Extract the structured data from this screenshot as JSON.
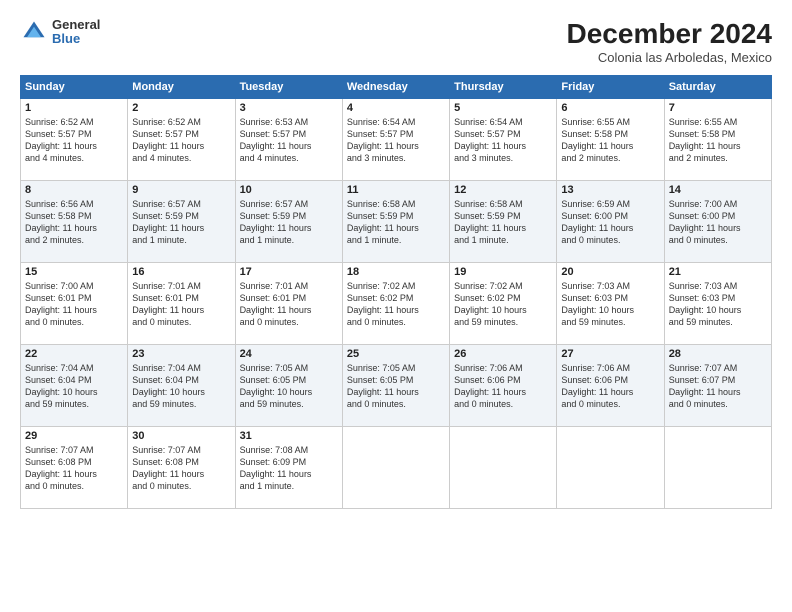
{
  "logo": {
    "line1": "General",
    "line2": "Blue"
  },
  "title": "December 2024",
  "location": "Colonia las Arboledas, Mexico",
  "weekdays": [
    "Sunday",
    "Monday",
    "Tuesday",
    "Wednesday",
    "Thursday",
    "Friday",
    "Saturday"
  ],
  "weeks": [
    [
      {
        "day": "1",
        "info": "Sunrise: 6:52 AM\nSunset: 5:57 PM\nDaylight: 11 hours\nand 4 minutes."
      },
      {
        "day": "2",
        "info": "Sunrise: 6:52 AM\nSunset: 5:57 PM\nDaylight: 11 hours\nand 4 minutes."
      },
      {
        "day": "3",
        "info": "Sunrise: 6:53 AM\nSunset: 5:57 PM\nDaylight: 11 hours\nand 4 minutes."
      },
      {
        "day": "4",
        "info": "Sunrise: 6:54 AM\nSunset: 5:57 PM\nDaylight: 11 hours\nand 3 minutes."
      },
      {
        "day": "5",
        "info": "Sunrise: 6:54 AM\nSunset: 5:57 PM\nDaylight: 11 hours\nand 3 minutes."
      },
      {
        "day": "6",
        "info": "Sunrise: 6:55 AM\nSunset: 5:58 PM\nDaylight: 11 hours\nand 2 minutes."
      },
      {
        "day": "7",
        "info": "Sunrise: 6:55 AM\nSunset: 5:58 PM\nDaylight: 11 hours\nand 2 minutes."
      }
    ],
    [
      {
        "day": "8",
        "info": "Sunrise: 6:56 AM\nSunset: 5:58 PM\nDaylight: 11 hours\nand 2 minutes."
      },
      {
        "day": "9",
        "info": "Sunrise: 6:57 AM\nSunset: 5:59 PM\nDaylight: 11 hours\nand 1 minute."
      },
      {
        "day": "10",
        "info": "Sunrise: 6:57 AM\nSunset: 5:59 PM\nDaylight: 11 hours\nand 1 minute."
      },
      {
        "day": "11",
        "info": "Sunrise: 6:58 AM\nSunset: 5:59 PM\nDaylight: 11 hours\nand 1 minute."
      },
      {
        "day": "12",
        "info": "Sunrise: 6:58 AM\nSunset: 5:59 PM\nDaylight: 11 hours\nand 1 minute."
      },
      {
        "day": "13",
        "info": "Sunrise: 6:59 AM\nSunset: 6:00 PM\nDaylight: 11 hours\nand 0 minutes."
      },
      {
        "day": "14",
        "info": "Sunrise: 7:00 AM\nSunset: 6:00 PM\nDaylight: 11 hours\nand 0 minutes."
      }
    ],
    [
      {
        "day": "15",
        "info": "Sunrise: 7:00 AM\nSunset: 6:01 PM\nDaylight: 11 hours\nand 0 minutes."
      },
      {
        "day": "16",
        "info": "Sunrise: 7:01 AM\nSunset: 6:01 PM\nDaylight: 11 hours\nand 0 minutes."
      },
      {
        "day": "17",
        "info": "Sunrise: 7:01 AM\nSunset: 6:01 PM\nDaylight: 11 hours\nand 0 minutes."
      },
      {
        "day": "18",
        "info": "Sunrise: 7:02 AM\nSunset: 6:02 PM\nDaylight: 11 hours\nand 0 minutes."
      },
      {
        "day": "19",
        "info": "Sunrise: 7:02 AM\nSunset: 6:02 PM\nDaylight: 10 hours\nand 59 minutes."
      },
      {
        "day": "20",
        "info": "Sunrise: 7:03 AM\nSunset: 6:03 PM\nDaylight: 10 hours\nand 59 minutes."
      },
      {
        "day": "21",
        "info": "Sunrise: 7:03 AM\nSunset: 6:03 PM\nDaylight: 10 hours\nand 59 minutes."
      }
    ],
    [
      {
        "day": "22",
        "info": "Sunrise: 7:04 AM\nSunset: 6:04 PM\nDaylight: 10 hours\nand 59 minutes."
      },
      {
        "day": "23",
        "info": "Sunrise: 7:04 AM\nSunset: 6:04 PM\nDaylight: 10 hours\nand 59 minutes."
      },
      {
        "day": "24",
        "info": "Sunrise: 7:05 AM\nSunset: 6:05 PM\nDaylight: 10 hours\nand 59 minutes."
      },
      {
        "day": "25",
        "info": "Sunrise: 7:05 AM\nSunset: 6:05 PM\nDaylight: 11 hours\nand 0 minutes."
      },
      {
        "day": "26",
        "info": "Sunrise: 7:06 AM\nSunset: 6:06 PM\nDaylight: 11 hours\nand 0 minutes."
      },
      {
        "day": "27",
        "info": "Sunrise: 7:06 AM\nSunset: 6:06 PM\nDaylight: 11 hours\nand 0 minutes."
      },
      {
        "day": "28",
        "info": "Sunrise: 7:07 AM\nSunset: 6:07 PM\nDaylight: 11 hours\nand 0 minutes."
      }
    ],
    [
      {
        "day": "29",
        "info": "Sunrise: 7:07 AM\nSunset: 6:08 PM\nDaylight: 11 hours\nand 0 minutes."
      },
      {
        "day": "30",
        "info": "Sunrise: 7:07 AM\nSunset: 6:08 PM\nDaylight: 11 hours\nand 0 minutes."
      },
      {
        "day": "31",
        "info": "Sunrise: 7:08 AM\nSunset: 6:09 PM\nDaylight: 11 hours\nand 1 minute."
      },
      null,
      null,
      null,
      null
    ]
  ]
}
